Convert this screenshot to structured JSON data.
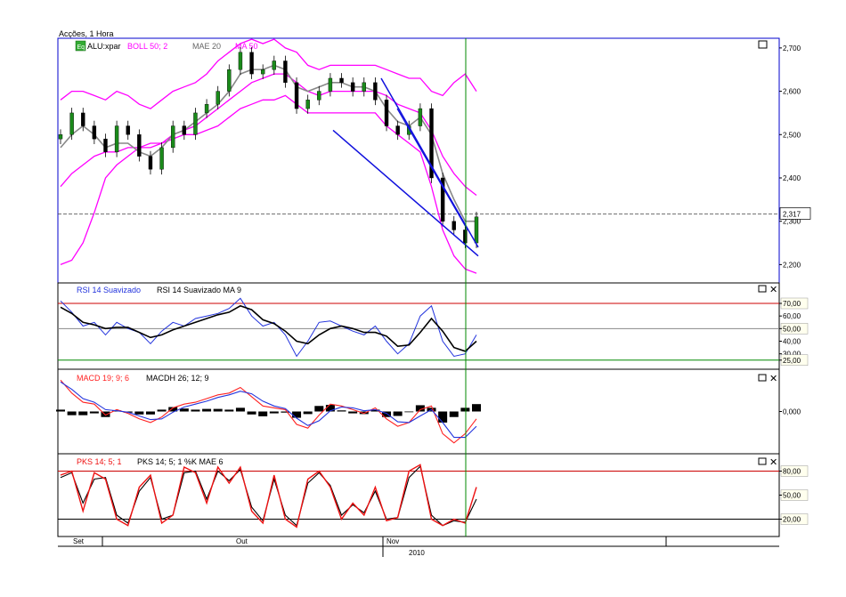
{
  "window": {
    "title": "Acções, 1 Hora"
  },
  "colors": {
    "frame": "#0000cc",
    "price_up": "#1a8a1a",
    "price_down": "#000000",
    "bollinger": "#ff00ff",
    "mae": "#888888",
    "ma": "#ff00ff",
    "trendline": "#1010dd",
    "rsi": "#2233dd",
    "rsi_ma": "#000000",
    "macd": "#ff2222",
    "macdh": "#000000",
    "signal": "#2233dd",
    "pks": "#ee1111",
    "pks_ma": "#000000",
    "level_line_red": "#cc0000",
    "level_line_green": "#008800",
    "cursor_line": "#008800"
  },
  "chart_data": [
    {
      "type": "line",
      "panel": "price",
      "legend": [
        {
          "icon": "eq-icon",
          "label": "ALU:xpar",
          "color": "#0000cc"
        },
        {
          "label": "BOLL 50; 2",
          "color": "#ff00ff"
        },
        {
          "label": "MAE 20",
          "color": "#888888"
        },
        {
          "label": "MA 50",
          "color": "#ff00ff"
        }
      ],
      "ylim": [
        2.17,
        2.71
      ],
      "yticks": [
        2.7,
        2.6,
        2.5,
        2.4,
        2.3,
        2.2
      ],
      "ytick_labels": [
        "2,700",
        "2,600",
        "2,500",
        "2,400",
        "2,300",
        "2,200"
      ],
      "last_price": 2.317,
      "last_price_label": "2,317",
      "series": [
        {
          "role": "close",
          "values": [
            2.5,
            2.55,
            2.52,
            2.49,
            2.46,
            2.52,
            2.5,
            2.45,
            2.42,
            2.47,
            2.52,
            2.5,
            2.55,
            2.57,
            2.6,
            2.65,
            2.69,
            2.64,
            2.65,
            2.67,
            2.62,
            2.56,
            2.58,
            2.6,
            2.63,
            2.62,
            2.6,
            2.62,
            2.58,
            2.52,
            2.5,
            2.52,
            2.56,
            2.4,
            2.3,
            2.28,
            2.25,
            2.31
          ]
        },
        {
          "role": "mae_20",
          "values": [
            2.47,
            2.5,
            2.52,
            2.5,
            2.47,
            2.48,
            2.48,
            2.46,
            2.45,
            2.47,
            2.5,
            2.51,
            2.53,
            2.55,
            2.57,
            2.6,
            2.64,
            2.65,
            2.65,
            2.66,
            2.65,
            2.61,
            2.6,
            2.61,
            2.62,
            2.62,
            2.61,
            2.61,
            2.6,
            2.56,
            2.53,
            2.52,
            2.54,
            2.5,
            2.41,
            2.35,
            2.3,
            2.3
          ]
        },
        {
          "role": "boll_upper",
          "values": [
            2.58,
            2.6,
            2.6,
            2.59,
            2.58,
            2.6,
            2.59,
            2.57,
            2.56,
            2.58,
            2.6,
            2.61,
            2.62,
            2.64,
            2.67,
            2.69,
            2.71,
            2.72,
            2.71,
            2.72,
            2.7,
            2.69,
            2.66,
            2.65,
            2.66,
            2.66,
            2.66,
            2.66,
            2.66,
            2.65,
            2.64,
            2.63,
            2.63,
            2.6,
            2.59,
            2.62,
            2.64,
            2.6
          ]
        },
        {
          "role": "boll_lower",
          "values": [
            2.2,
            2.21,
            2.25,
            2.32,
            2.4,
            2.43,
            2.45,
            2.47,
            2.48,
            2.48,
            2.49,
            2.5,
            2.5,
            2.51,
            2.52,
            2.54,
            2.56,
            2.57,
            2.58,
            2.58,
            2.59,
            2.57,
            2.55,
            2.55,
            2.55,
            2.55,
            2.55,
            2.55,
            2.55,
            2.52,
            2.5,
            2.48,
            2.46,
            2.38,
            2.28,
            2.22,
            2.19,
            2.18
          ]
        },
        {
          "role": "ma_50",
          "values": [
            2.38,
            2.41,
            2.43,
            2.45,
            2.46,
            2.46,
            2.47,
            2.47,
            2.47,
            2.48,
            2.5,
            2.51,
            2.52,
            2.54,
            2.56,
            2.58,
            2.6,
            2.62,
            2.63,
            2.64,
            2.64,
            2.62,
            2.6,
            2.59,
            2.6,
            2.6,
            2.6,
            2.6,
            2.6,
            2.59,
            2.57,
            2.56,
            2.55,
            2.51,
            2.45,
            2.41,
            2.38,
            2.36
          ]
        }
      ]
    },
    {
      "type": "line",
      "panel": "rsi",
      "legend": [
        {
          "label": "RSI 14 Suavizado",
          "color": "#2233dd"
        },
        {
          "label": "RSI 14 Suavizado MA 9",
          "color": "#000000"
        }
      ],
      "ylim": [
        22,
        82
      ],
      "levels": [
        70,
        50,
        25
      ],
      "ytick_labels": [
        "70,00",
        "60,00",
        "50,00",
        "40,00",
        "30,00",
        "25,00"
      ],
      "yticks": [
        70,
        60,
        50,
        40,
        30,
        25
      ],
      "series": [
        {
          "role": "rsi",
          "values": [
            72,
            63,
            52,
            55,
            45,
            55,
            50,
            47,
            38,
            48,
            55,
            52,
            58,
            60,
            62,
            66,
            74,
            60,
            52,
            55,
            45,
            28,
            40,
            55,
            56,
            52,
            48,
            45,
            52,
            40,
            30,
            38,
            60,
            68,
            40,
            28,
            30,
            45
          ]
        },
        {
          "role": "rsi_ma",
          "values": [
            67,
            62,
            55,
            53,
            50,
            51,
            51,
            47,
            43,
            45,
            49,
            52,
            55,
            58,
            61,
            63,
            68,
            65,
            57,
            54,
            48,
            40,
            38,
            45,
            50,
            52,
            50,
            47,
            47,
            44,
            36,
            37,
            47,
            58,
            48,
            35,
            32,
            40
          ]
        }
      ]
    },
    {
      "type": "bar",
      "panel": "macd",
      "legend": [
        {
          "label": "MACD 19; 9; 6",
          "color": "#ff2222"
        },
        {
          "label": "MACDH 26; 12; 9",
          "color": "#000000"
        }
      ],
      "ylim": [
        -1,
        1
      ],
      "yticks": [
        0
      ],
      "ytick_labels": [
        "0,000"
      ],
      "series": [
        {
          "role": "macd",
          "values": [
            0.85,
            0.5,
            0.25,
            0.2,
            -0.1,
            0.05,
            -0.05,
            -0.2,
            -0.3,
            -0.15,
            0.1,
            0.2,
            0.25,
            0.35,
            0.45,
            0.5,
            0.65,
            0.4,
            0.15,
            0.1,
            0.05,
            -0.35,
            -0.45,
            -0.1,
            0.2,
            0.15,
            0.05,
            -0.05,
            0.1,
            -0.2,
            -0.4,
            -0.3,
            0.05,
            0.15,
            -0.6,
            -0.85,
            -0.6,
            -0.2
          ]
        },
        {
          "role": "signal",
          "values": [
            0.8,
            0.6,
            0.35,
            0.25,
            0.05,
            0.02,
            -0.02,
            -0.12,
            -0.22,
            -0.2,
            -0.02,
            0.12,
            0.2,
            0.28,
            0.38,
            0.45,
            0.55,
            0.48,
            0.28,
            0.15,
            0.08,
            -0.18,
            -0.38,
            -0.25,
            0.02,
            0.12,
            0.1,
            0.02,
            0.05,
            -0.05,
            -0.28,
            -0.3,
            -0.12,
            0.05,
            -0.3,
            -0.7,
            -0.7,
            -0.4
          ]
        },
        {
          "role": "histogram",
          "values": [
            0.05,
            -0.1,
            -0.1,
            -0.05,
            -0.15,
            0.03,
            -0.03,
            -0.08,
            -0.08,
            0.05,
            0.12,
            0.08,
            0.05,
            0.07,
            0.07,
            0.05,
            0.1,
            -0.08,
            -0.13,
            -0.05,
            -0.03,
            -0.17,
            -0.07,
            0.15,
            0.18,
            0.03,
            -0.05,
            -0.07,
            0.05,
            -0.15,
            -0.12,
            0.0,
            0.17,
            0.1,
            -0.3,
            -0.15,
            0.1,
            0.2
          ]
        }
      ]
    },
    {
      "type": "line",
      "panel": "stochastic",
      "legend": [
        {
          "label": "PKS 14; 5; 1",
          "color": "#ee1111"
        },
        {
          "label": "PKS 14; 5; 1 %K MAE 6",
          "color": "#000000"
        }
      ],
      "ylim": [
        5,
        95
      ],
      "levels": [
        80,
        20
      ],
      "yticks": [
        80,
        50,
        20
      ],
      "ytick_labels": [
        "80,00",
        "50,00",
        "20,00"
      ],
      "series": [
        {
          "role": "pks",
          "values": [
            75,
            80,
            30,
            78,
            70,
            20,
            12,
            60,
            75,
            15,
            25,
            85,
            78,
            40,
            85,
            65,
            85,
            30,
            15,
            75,
            20,
            10,
            70,
            80,
            60,
            20,
            40,
            25,
            60,
            18,
            22,
            80,
            88,
            20,
            12,
            20,
            15,
            60
          ]
        },
        {
          "role": "pks_ma",
          "values": [
            72,
            78,
            40,
            70,
            72,
            25,
            15,
            55,
            72,
            20,
            25,
            78,
            80,
            45,
            80,
            68,
            82,
            35,
            18,
            70,
            25,
            12,
            65,
            78,
            62,
            25,
            38,
            28,
            55,
            20,
            22,
            72,
            86,
            25,
            12,
            18,
            16,
            45
          ]
        }
      ]
    }
  ],
  "x_axis": {
    "labels": [
      "Set",
      "Out",
      "Nov"
    ],
    "year_label": "2010"
  }
}
